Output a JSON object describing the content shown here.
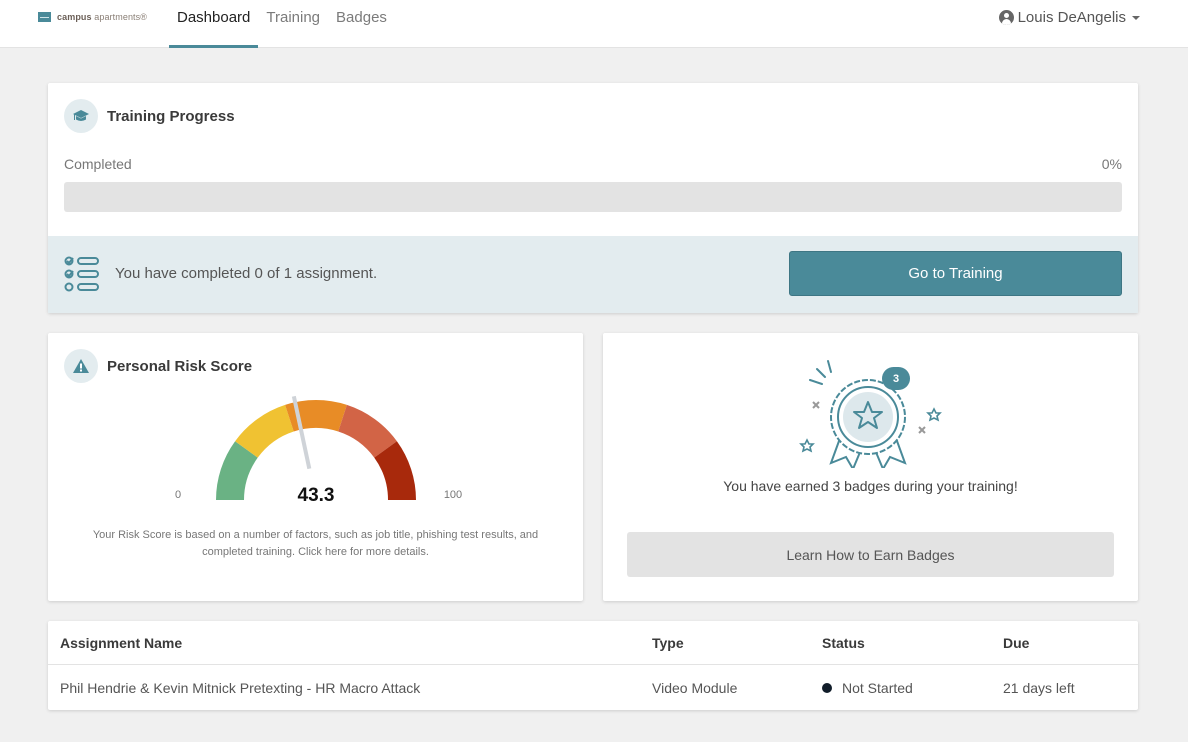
{
  "app": {
    "logo_bold": "campus",
    "logo_light": "apartments®"
  },
  "nav": {
    "tabs": [
      {
        "label": "Dashboard",
        "active": true
      },
      {
        "label": "Training",
        "active": false
      },
      {
        "label": "Badges",
        "active": false
      }
    ],
    "user_name": "Louis DeAngelis"
  },
  "training_progress": {
    "title": "Training Progress",
    "completed_label": "Completed",
    "completed_percent_label": "0%",
    "completed_fraction": 0,
    "summary": "You have completed 0 of 1 assignment.",
    "go_button": "Go to Training"
  },
  "risk_score": {
    "title": "Personal Risk Score",
    "value": 43.3,
    "value_label": "43.3",
    "min_label": "0",
    "max_label": "100",
    "min": 0,
    "max": 100,
    "segments": [
      {
        "from": 0,
        "to": 20,
        "color": "#6ab284"
      },
      {
        "from": 20,
        "to": 40,
        "color": "#f0c232"
      },
      {
        "from": 40,
        "to": 60,
        "color": "#e88c26"
      },
      {
        "from": 60,
        "to": 80,
        "color": "#d26446"
      },
      {
        "from": 80,
        "to": 100,
        "color": "#a8290c"
      }
    ],
    "description": "Your Risk Score is based on a number of factors, such as job title, phishing test results, and completed training. Click here for more details."
  },
  "badges": {
    "count": "3",
    "message": "You have earned 3 badges during your training!",
    "learn_button": "Learn How to Earn Badges"
  },
  "assignments": {
    "columns": [
      "Assignment Name",
      "Type",
      "Status",
      "Due"
    ],
    "rows": [
      {
        "name": "Phil Hendrie & Kevin Mitnick Pretexting - HR Macro Attack",
        "type": "Video Module",
        "status": "Not Started",
        "due": "21 days left"
      }
    ]
  },
  "colors": {
    "accent": "#4a8a99",
    "status_not_started": "#111d2a"
  }
}
